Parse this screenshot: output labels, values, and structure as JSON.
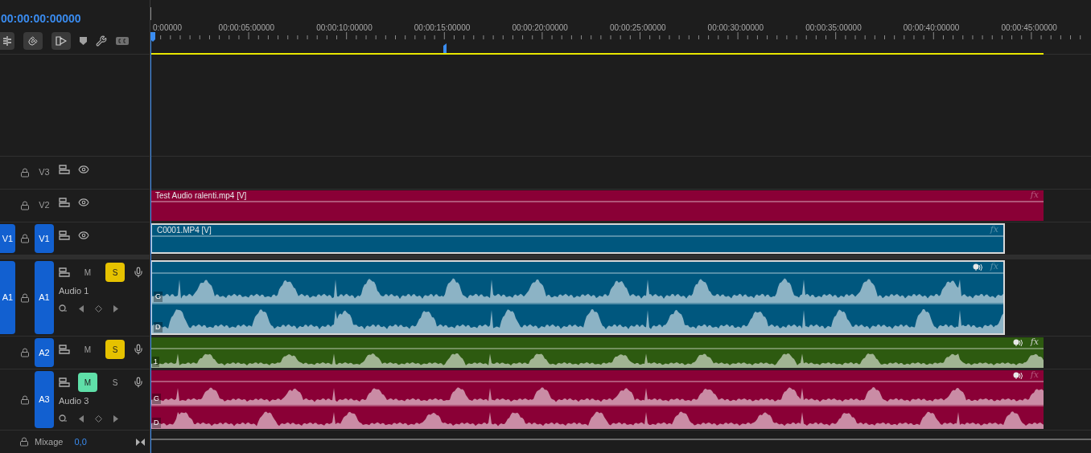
{
  "timecode": "00:00:00:00000",
  "ruler": {
    "labels": [
      "0:00000",
      "00:00:05:00000",
      "00:00:10:00000",
      "00:00:15:00000",
      "00:00:20:00000",
      "00:00:25:00000",
      "00:00:30:00000",
      "00:00:35:00000",
      "00:00:40:00000",
      "00:00:45:00000"
    ]
  },
  "tracks": [
    {
      "kind": "video",
      "target": {
        "label": "V3",
        "selected": false
      }
    },
    {
      "kind": "video",
      "target": {
        "label": "V2",
        "selected": false
      },
      "clip": {
        "name": "Test Audio ralenti.mp4 [V]",
        "color": "#8a0036",
        "selected": false,
        "fx": "fx",
        "fx_active": false
      }
    },
    {
      "kind": "video",
      "source": {
        "label": "V1"
      },
      "target": {
        "label": "V1",
        "selected": true
      },
      "clip": {
        "name": "C0001.MP4 [V]",
        "color": "#00577e",
        "selected": true,
        "fx": "fx",
        "fx_active": false
      }
    },
    {
      "kind": "audio",
      "source": {
        "label": "A1"
      },
      "target": {
        "label": "A1",
        "selected": true
      },
      "name": "Audio 1",
      "mute": {
        "label": "M",
        "on": false
      },
      "solo": {
        "label": "S",
        "on": true
      },
      "clip": {
        "color": "#00577e",
        "selected": true,
        "fx": "fx",
        "fx_active": false,
        "channels": [
          "G",
          "D"
        ]
      }
    },
    {
      "kind": "audio",
      "target": {
        "label": "A2",
        "selected": true
      },
      "mute": {
        "label": "M",
        "on": false
      },
      "solo": {
        "label": "S",
        "on": true
      },
      "clip": {
        "color": "#2d5a10",
        "selected": false,
        "fx": "fx",
        "fx_active": true,
        "channels": [
          "1"
        ]
      }
    },
    {
      "kind": "audio",
      "target": {
        "label": "A3",
        "selected": true
      },
      "name": "Audio 3",
      "mute": {
        "label": "M",
        "on": true
      },
      "solo": {
        "label": "S",
        "on": false
      },
      "clip": {
        "color": "#8a0036",
        "selected": false,
        "fx": "fx",
        "fx_active": false,
        "channels": [
          "G",
          "D"
        ]
      }
    }
  ],
  "mix": {
    "label": "Mixage",
    "value": "0,0"
  }
}
